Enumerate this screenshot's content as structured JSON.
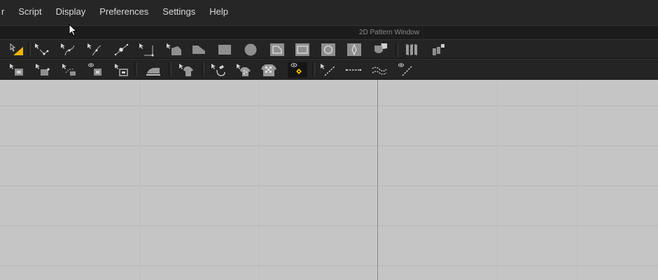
{
  "menu": {
    "items": [
      {
        "label": "r"
      },
      {
        "label": "Script"
      },
      {
        "label": "Display"
      },
      {
        "label": "Preferences"
      },
      {
        "label": "Settings"
      },
      {
        "label": "Help"
      }
    ]
  },
  "window": {
    "title": "2D Pattern Window"
  },
  "toolbar_top": {
    "tools": [
      "select-transform-icon",
      "edit-point-icon",
      "edit-curve-point-icon",
      "curve-point-icon",
      "add-point-icon",
      "set-polygon-icon",
      "internal-polygon-icon",
      "polygon-icon",
      "rectangle-icon",
      "circle-icon",
      "internal-polygon-line-icon",
      "internal-rectangle-icon",
      "internal-circle-icon",
      "dart-icon",
      "trace-icon",
      "fold-arrangement-icon",
      "baseline-icon"
    ]
  },
  "toolbar_bottom": {
    "tools": [
      "transform-pattern-icon",
      "edit-pattern-icon",
      "edit-sewing-icon",
      "show-sewing-icon",
      "sewing-sub-icon",
      "steam-iron-icon",
      "garment-fit-icon",
      "fabric-tool-icon",
      "edit-texture-icon",
      "graphic-icon",
      "show-graphics-icon",
      "segment-sewing-icon",
      "free-sewing-icon",
      "tack-icon",
      "topstitch-icon"
    ]
  },
  "colors": {
    "accent": "#f2b600",
    "canvas": "#c5c5c5",
    "menubar": "#262626",
    "toolbar": "#242424"
  }
}
